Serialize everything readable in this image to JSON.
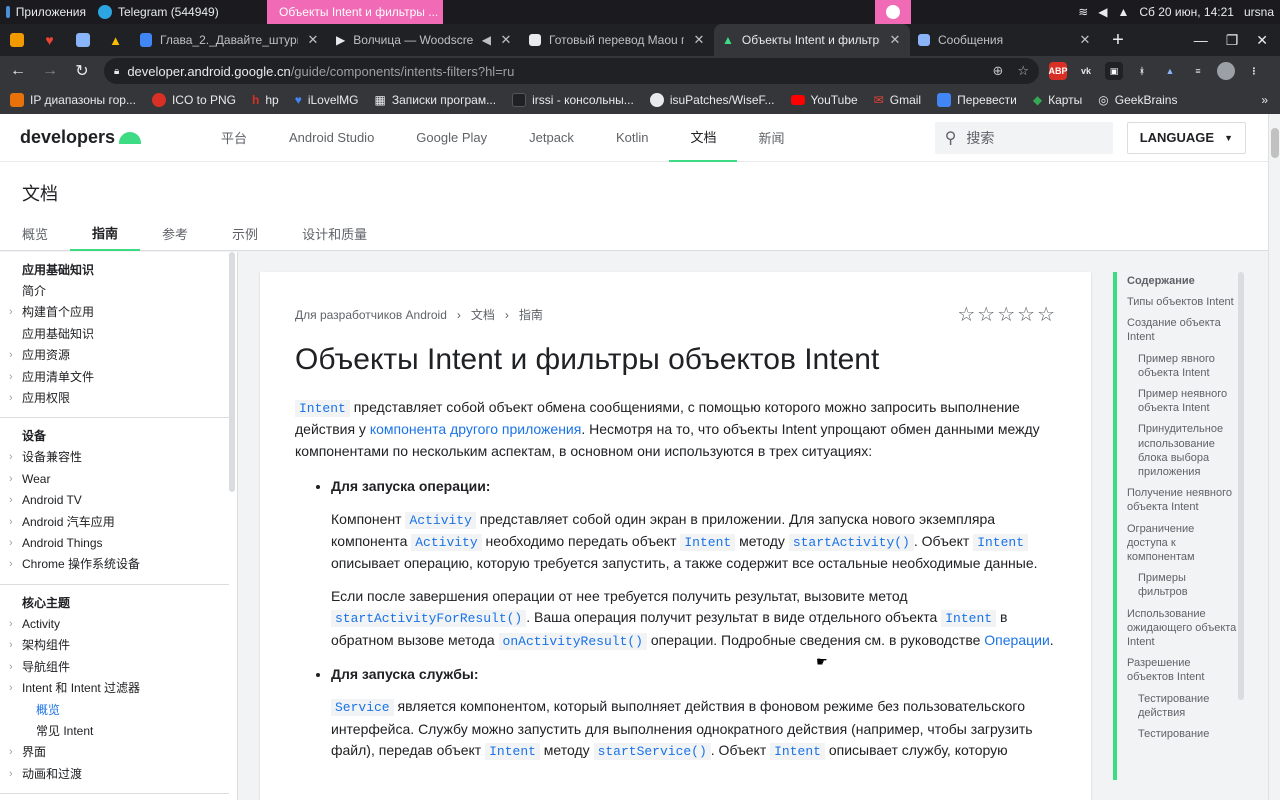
{
  "os": {
    "apps": "Приложения",
    "telegram": "Telegram (544949)",
    "active_task": "Объекты Intent и фильтры ...",
    "clock": "Сб 20 июн, 14:21",
    "user": "ursna"
  },
  "tabs": [
    {
      "title": "Глава_2._Давайте_штурмо",
      "icon": "docs-icon"
    },
    {
      "title": "Волчица — Woodscre",
      "icon": "play-icon"
    },
    {
      "title": "Готовый перевод Maou по",
      "icon": "doc-icon"
    },
    {
      "title": "Объекты Intent и фильтры",
      "icon": "android-icon",
      "active": true
    },
    {
      "title": "Сообщения",
      "icon": "chat-icon"
    }
  ],
  "omnibox": {
    "host": "developer.android.google.cn",
    "path": "/guide/components/intents-filters?hl=ru"
  },
  "bookmarks": [
    {
      "label": "IP диапазоны гор...",
      "color": "#e8710a"
    },
    {
      "label": "ICO to PNG",
      "color": "#d93025"
    },
    {
      "label": "hp",
      "color": "#d93025"
    },
    {
      "label": "iLovelMG",
      "color": "#4285f4"
    },
    {
      "label": "Записки програм...",
      "color": "#9aa0a6"
    },
    {
      "label": "irssi - консольны...",
      "color": "#202124"
    },
    {
      "label": "isuPatches/WiseF...",
      "color": "#e8eaed"
    },
    {
      "label": "YouTube",
      "color": "#ff0000"
    },
    {
      "label": "Gmail",
      "color": "#ea4335"
    },
    {
      "label": "Перевести",
      "color": "#4285f4"
    },
    {
      "label": "Карты",
      "color": "#34a853"
    },
    {
      "label": "GeekBrains",
      "color": "#e8eaed"
    }
  ],
  "site": {
    "logo": "developers",
    "nav": [
      "平台",
      "Android Studio",
      "Google Play",
      "Jetpack",
      "Kotlin",
      "文档",
      "新闻"
    ],
    "search_placeholder": "搜索",
    "language": "LANGUAGE",
    "section": "文档",
    "subtabs": [
      "概览",
      "指南",
      "参考",
      "示例",
      "设计和质量"
    ]
  },
  "leftnav": {
    "groups": [
      {
        "title": "应用基础知识",
        "items": [
          {
            "label": "简介"
          },
          {
            "label": "构建首个应用",
            "exp": true
          },
          {
            "label": "应用基础知识"
          },
          {
            "label": "应用资源",
            "exp": true
          },
          {
            "label": "应用清单文件",
            "exp": true
          },
          {
            "label": "应用权限",
            "exp": true
          }
        ]
      },
      {
        "title": "设备",
        "items": [
          {
            "label": "设备兼容性",
            "exp": true
          },
          {
            "label": "Wear",
            "exp": true
          },
          {
            "label": "Android TV",
            "exp": true
          },
          {
            "label": "Android 汽车应用",
            "exp": true
          },
          {
            "label": "Android Things",
            "exp": true
          },
          {
            "label": "Chrome 操作系统设备",
            "exp": true
          }
        ]
      },
      {
        "title": "核心主题",
        "items": [
          {
            "label": "Activity",
            "exp": true
          },
          {
            "label": "架构组件",
            "exp": true
          },
          {
            "label": "导航组件",
            "exp": true
          },
          {
            "label": "Intent 和 Intent 过滤器",
            "exp": true
          },
          {
            "label": "概览",
            "sub": true,
            "cur": true
          },
          {
            "label": "常见 Intent",
            "sub": true
          },
          {
            "label": "界面",
            "exp": true
          },
          {
            "label": "动画和过渡",
            "exp": true
          }
        ]
      }
    ]
  },
  "article": {
    "breadcrumbs": [
      "Для разработчиков Android",
      "文档",
      "指南"
    ],
    "title": "Объекты Intent и фильтры объектов Intent",
    "intro_code": "Intent",
    "intro_1": " представляет собой объект обмена сообщениями, с помощью которого можно запросить выполнение действия у ",
    "intro_link": "компонента другого приложения",
    "intro_2": ". Несмотря на то, что объекты Intent упрощают обмен данными между компонентами по нескольким аспектам, в основном они используются в трех ситуациях:",
    "s1_title": "Для запуска операции:",
    "s1_p1": [
      "Компонент ",
      "Activity",
      " представляет собой один экран в приложении. Для запуска нового экземпляра компонента ",
      "Activity",
      " необходимо передать объект ",
      "Intent",
      " методу ",
      "startActivity()",
      ". Объект ",
      "Intent",
      " описывает операцию, которую требуется запустить, а также содержит все остальные необходимые данные."
    ],
    "s1_p2": [
      "Если после завершения операции от нее требуется получить результат, вызовите метод ",
      "startActivityForResult()",
      ". Ваша операция получит результат в виде отдельного объекта ",
      "Intent",
      " в обратном вызове метода ",
      "onActivityResult()",
      " операции. Подробные сведения см. в руководстве ",
      "Операции",
      "."
    ],
    "s2_title": "Для запуска службы:",
    "s2_p1": [
      "Service",
      " является компонентом, который выполняет действия в фоновом режиме без пользовательского интерфейса. Службу можно запустить для выполнения однократного действия (например, чтобы загрузить файл), передав объект ",
      "Intent",
      " методу ",
      "startService()",
      ". Объект ",
      "Intent",
      " описывает службу, которую"
    ]
  },
  "toc": {
    "title": "Содержание",
    "items": [
      {
        "label": "Типы объектов Intent"
      },
      {
        "label": "Создание объекта Intent"
      },
      {
        "label": "Пример явного объекта Intent",
        "sub": true
      },
      {
        "label": "Пример неявного объекта Intent",
        "sub": true
      },
      {
        "label": "Принудительное использование блока выбора приложения",
        "sub": true
      },
      {
        "label": "Получение неявного объекта Intent"
      },
      {
        "label": "Ограничение доступа к компонентам"
      },
      {
        "label": "Примеры фильтров",
        "sub": true
      },
      {
        "label": "Использование ожидающего объекта Intent"
      },
      {
        "label": "Разрешение объектов Intent"
      },
      {
        "label": "Тестирование действия",
        "sub": true
      },
      {
        "label": "Тестирование",
        "sub": true
      }
    ]
  }
}
